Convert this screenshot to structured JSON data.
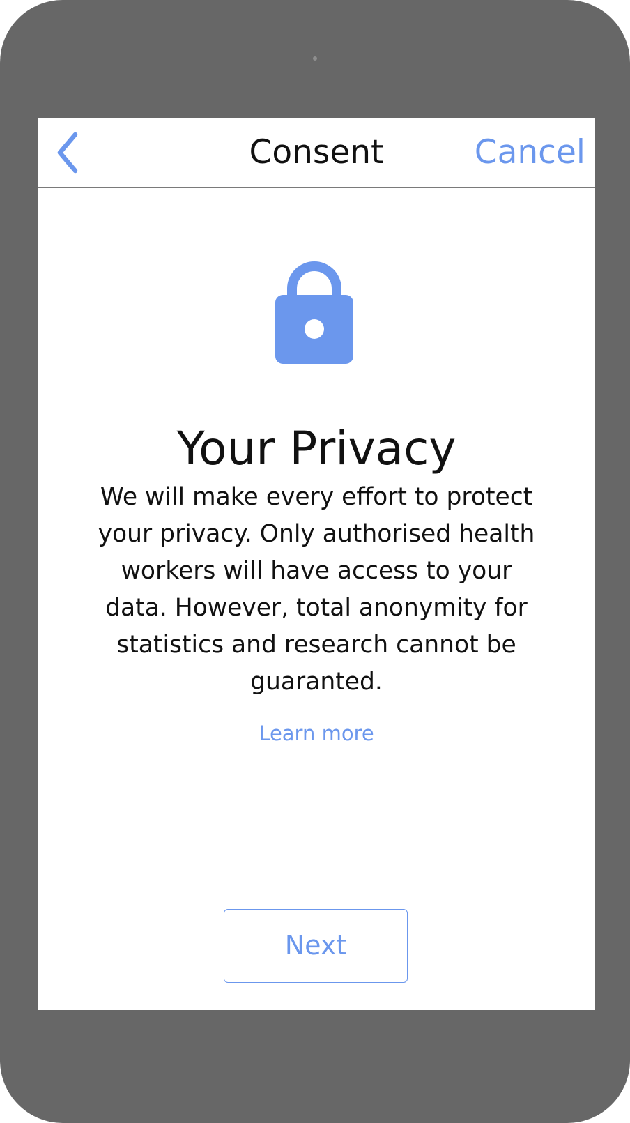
{
  "navbar": {
    "back_icon": "chevron-left-icon",
    "title": "Consent",
    "cancel_label": "Cancel"
  },
  "content": {
    "icon": "lock-icon",
    "heading": "Your Privacy",
    "body": "We will make every effort to protect your privacy. Only authorised health workers will have access to your data. However, total anonymity for statistics and research cannot be guaranted.",
    "learn_more_label": "Learn more"
  },
  "footer": {
    "next_label": "Next"
  },
  "colors": {
    "accent": "#6b97ed",
    "device_frame": "#676767",
    "text": "#111111",
    "background": "#ffffff"
  }
}
